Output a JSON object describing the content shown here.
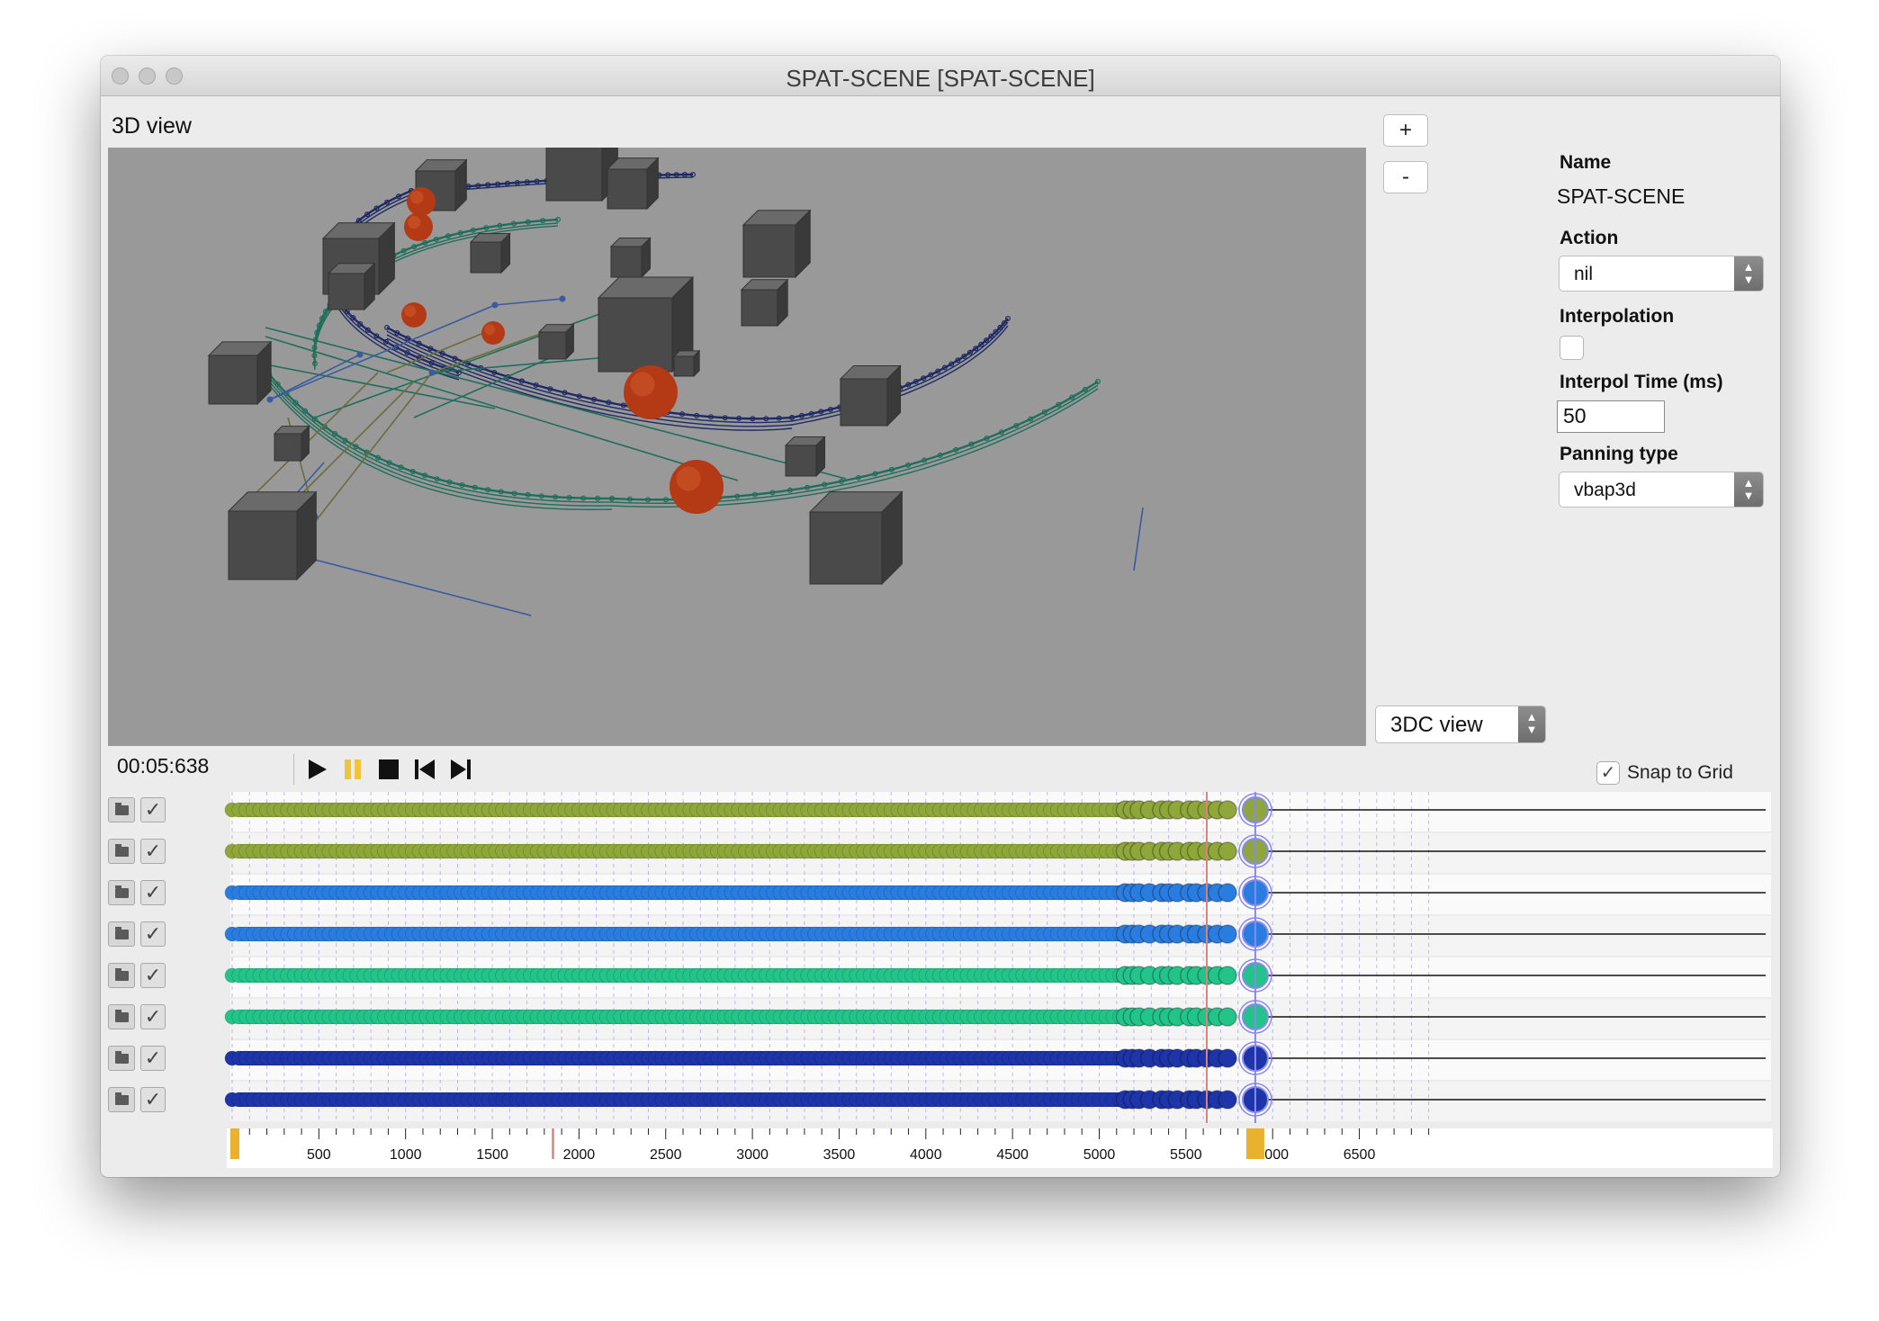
{
  "window": {
    "title": "SPAT-SCENE [SPAT-SCENE]"
  },
  "view": {
    "label": "3D view",
    "zoom_in": "+",
    "zoom_out": "-",
    "mode_select": "3DC view"
  },
  "properties": {
    "name_label": "Name",
    "name_value": "SPAT-SCENE",
    "action_label": "Action",
    "action_value": "nil",
    "interpolation_label": "Interpolation",
    "interpolation_checked": false,
    "interpol_time_label": "Interpol Time (ms)",
    "interpol_time_value": "50",
    "panning_label": "Panning type",
    "panning_value": "vbap3d"
  },
  "transport": {
    "time": "00:05:638",
    "buttons": [
      "play-icon",
      "pause-icon",
      "stop-icon",
      "skip-start-icon",
      "skip-end-icon"
    ]
  },
  "timeline": {
    "snap_to_grid_label": "Snap to Grid",
    "snap_to_grid_checked": true,
    "ticks": [
      "500",
      "1000",
      "1500",
      "2000",
      "2500",
      "3000",
      "3500",
      "4000",
      "4500",
      "5000",
      "5500",
      "6000",
      "6500"
    ],
    "tracks": [
      {
        "color": "#8fa63a",
        "enabled": true
      },
      {
        "color": "#8fa63a",
        "enabled": true
      },
      {
        "color": "#2a7de0",
        "enabled": true
      },
      {
        "color": "#2a7de0",
        "enabled": true
      },
      {
        "color": "#22c48a",
        "enabled": true
      },
      {
        "color": "#22c48a",
        "enabled": true
      },
      {
        "color": "#1d35a8",
        "enabled": true
      },
      {
        "color": "#1d35a8",
        "enabled": true
      }
    ],
    "colors": {
      "cursor": "#d7837e",
      "marker": "#e9b22e",
      "grid": "#8888ee"
    }
  },
  "scene_colors": {
    "background": "#999999",
    "cube": "#4a4a4a",
    "sphere": "#b43a16",
    "path_navy": "#1f2a64",
    "path_green": "#1f6e5a",
    "path_olive": "#6c6c3c",
    "path_blue": "#3a5aa0"
  }
}
